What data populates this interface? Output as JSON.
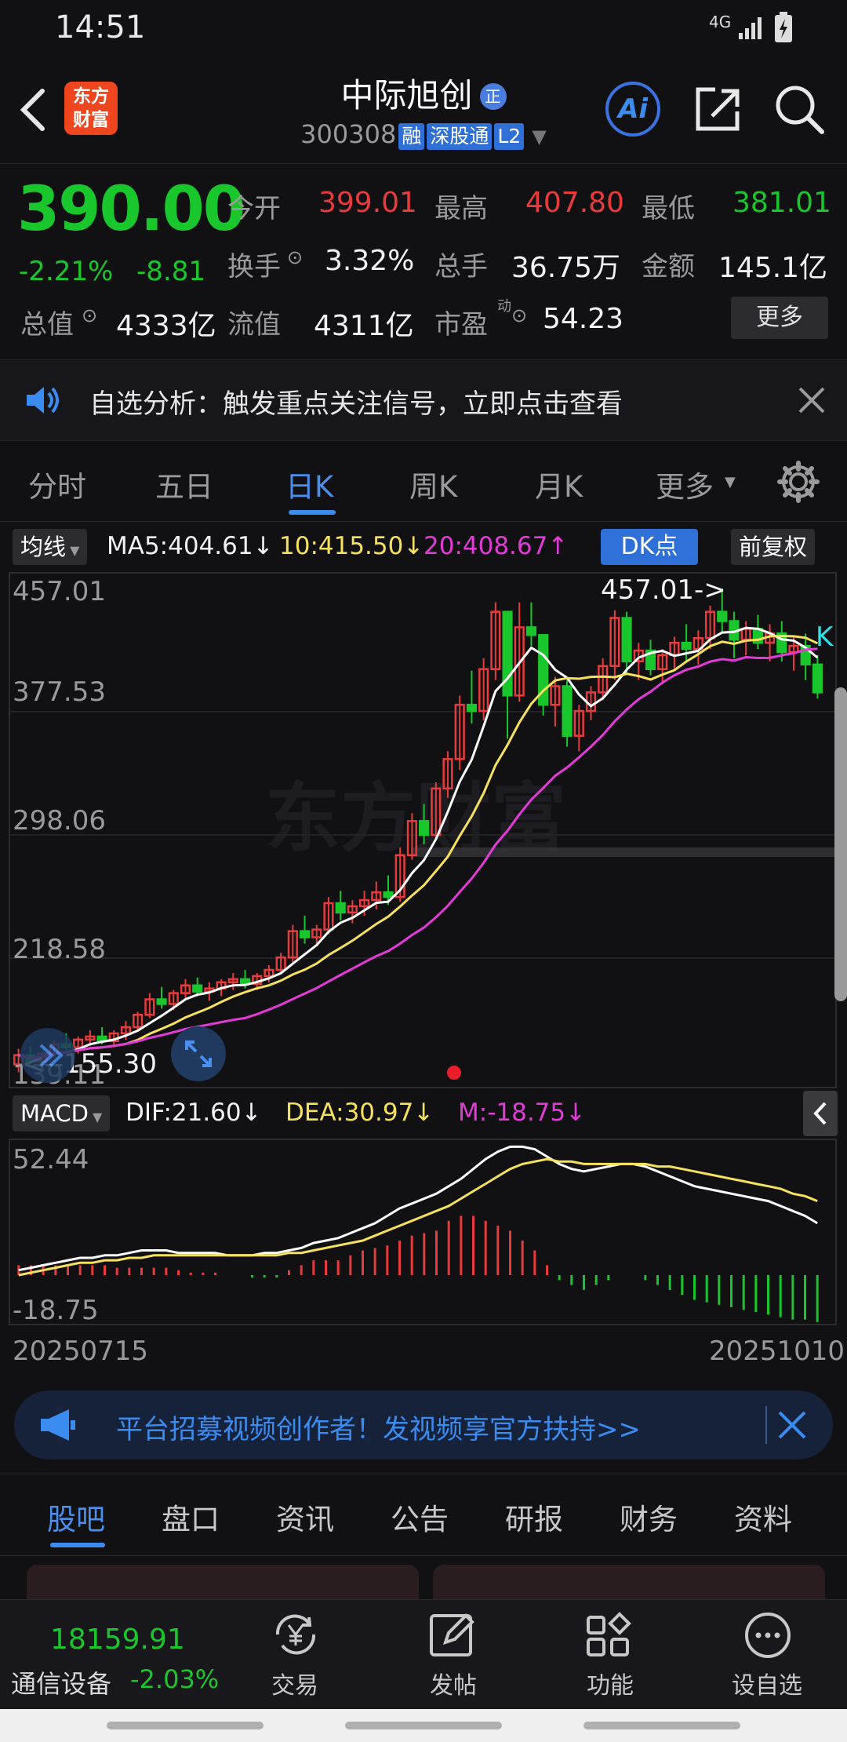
{
  "status": {
    "time": "14:51",
    "network": "4G"
  },
  "header": {
    "logo_line1": "东方",
    "logo_line2": "财富",
    "stock_name": "中际旭创",
    "stock_badge": "正",
    "stock_code": "300308",
    "tags": [
      "融",
      "深股通",
      "L2"
    ],
    "ai_label": "Ai"
  },
  "quote": {
    "price": "390.00",
    "change_pct": "-2.21%",
    "change_abs": "-8.81",
    "open_label": "今开",
    "open": "399.01",
    "high_label": "最高",
    "high": "407.80",
    "low_label": "最低",
    "low": "381.01",
    "turnover_label": "换手",
    "turnover": "3.32%",
    "volume_label": "总手",
    "volume": "36.75万",
    "amount_label": "金额",
    "amount": "145.1亿",
    "mcap_label": "总值",
    "mcap": "4333亿",
    "float_label": "流值",
    "float_cap": "4311亿",
    "pe_label": "市盈",
    "pe_sup": "动",
    "pe": "54.23",
    "more_label": "更多"
  },
  "notice": {
    "text": "自选分析：触发重点关注信号，立即点击查看"
  },
  "period_tabs": [
    {
      "label": "分时"
    },
    {
      "label": "五日"
    },
    {
      "label": "日K"
    },
    {
      "label": "周K"
    },
    {
      "label": "月K"
    },
    {
      "label": "更多"
    }
  ],
  "active_period": "日K",
  "ma_bar": {
    "chip": "均线",
    "ma5": "MA5:404.61↓",
    "ma10": "10:415.50↓",
    "ma20": "20:408.67↑",
    "dk": "DK点",
    "adjust": "前复权"
  },
  "colors": {
    "up": "#e83b3b",
    "down": "#19c62c",
    "ma5": "#ffffff",
    "ma10": "#f5e15a",
    "ma20": "#e23ad6",
    "accent": "#2f6fd8"
  },
  "chart_data": [
    {
      "type": "candlestick",
      "y_ticks": [
        "457.01",
        "377.53",
        "298.06",
        "218.58",
        "139.11"
      ],
      "ylim": [
        139.11,
        457.01
      ],
      "annotations": [
        {
          "text": "457.01->"
        },
        {
          "text": "<--155.30"
        }
      ],
      "k_marker": "K",
      "x_start": "20250715",
      "x_end": "20251010",
      "candles": [
        [
          150,
          160,
          145,
          156
        ],
        [
          156,
          162,
          150,
          152
        ],
        [
          152,
          158,
          148,
          157
        ],
        [
          157,
          166,
          155,
          163
        ],
        [
          163,
          170,
          159,
          161
        ],
        [
          161,
          168,
          157,
          166
        ],
        [
          166,
          172,
          162,
          168
        ],
        [
          168,
          174,
          163,
          165
        ],
        [
          165,
          172,
          161,
          170
        ],
        [
          170,
          178,
          166,
          174
        ],
        [
          174,
          184,
          171,
          182
        ],
        [
          182,
          196,
          180,
          192
        ],
        [
          192,
          200,
          186,
          189
        ],
        [
          189,
          198,
          185,
          196
        ],
        [
          196,
          205,
          192,
          201
        ],
        [
          201,
          206,
          194,
          197
        ],
        [
          197,
          203,
          191,
          199
        ],
        [
          199,
          205,
          194,
          203
        ],
        [
          203,
          209,
          198,
          205
        ],
        [
          205,
          211,
          199,
          202
        ],
        [
          202,
          209,
          198,
          207
        ],
        [
          207,
          214,
          203,
          211
        ],
        [
          211,
          222,
          208,
          219
        ],
        [
          219,
          240,
          216,
          236
        ],
        [
          236,
          246,
          228,
          232
        ],
        [
          232,
          240,
          226,
          237
        ],
        [
          237,
          258,
          234,
          254
        ],
        [
          254,
          262,
          243,
          248
        ],
        [
          248,
          256,
          241,
          252
        ],
        [
          252,
          262,
          246,
          256
        ],
        [
          256,
          268,
          250,
          261
        ],
        [
          261,
          272,
          253,
          258
        ],
        [
          258,
          290,
          255,
          285
        ],
        [
          285,
          312,
          282,
          307
        ],
        [
          307,
          318,
          292,
          298
        ],
        [
          298,
          332,
          295,
          328
        ],
        [
          328,
          352,
          322,
          347
        ],
        [
          347,
          388,
          340,
          382
        ],
        [
          382,
          404,
          370,
          378
        ],
        [
          378,
          412,
          372,
          405
        ],
        [
          405,
          448,
          398,
          442
        ],
        [
          442,
          437,
          360,
          388
        ],
        [
          388,
          448,
          384,
          432
        ],
        [
          432,
          448,
          420,
          427
        ],
        [
          427,
          420,
          375,
          382
        ],
        [
          382,
          400,
          368,
          394
        ],
        [
          394,
          398,
          355,
          362
        ],
        [
          362,
          382,
          352,
          378
        ],
        [
          378,
          394,
          372,
          390
        ],
        [
          390,
          412,
          385,
          407
        ],
        [
          407,
          443,
          398,
          438
        ],
        [
          438,
          442,
          402,
          410
        ],
        [
          410,
          422,
          398,
          417
        ],
        [
          417,
          424,
          401,
          405
        ],
        [
          405,
          418,
          396,
          414
        ],
        [
          414,
          426,
          404,
          422
        ],
        [
          422,
          434,
          410,
          418
        ],
        [
          418,
          430,
          408,
          425
        ],
        [
          425,
          446,
          418,
          442
        ],
        [
          442,
          457,
          428,
          436
        ],
        [
          436,
          442,
          412,
          424
        ],
        [
          424,
          436,
          414,
          431
        ],
        [
          431,
          440,
          418,
          422
        ],
        [
          422,
          434,
          410,
          428
        ],
        [
          428,
          436,
          410,
          416
        ],
        [
          416,
          426,
          404,
          420
        ],
        [
          420,
          428,
          398,
          408
        ],
        [
          408,
          414,
          386,
          390
        ]
      ]
    },
    {
      "type": "macd",
      "indicator_chip": "MACD",
      "dif_label": "DIF:21.60↓",
      "dea_label": "DEA:30.97↓",
      "m_label": "M:-18.75↓",
      "y_ticks": [
        "52.44",
        "-18.75"
      ],
      "ylim": [
        -18.75,
        52.44
      ],
      "dif": [
        2,
        3,
        4,
        5,
        6,
        7,
        7,
        8,
        8,
        9,
        10,
        10,
        10,
        9,
        9,
        9,
        9,
        8,
        8,
        8,
        9,
        9,
        10,
        11,
        13,
        14,
        15,
        17,
        19,
        21,
        24,
        27,
        29,
        31,
        33,
        36,
        39,
        43,
        47,
        50,
        52,
        52,
        51,
        48,
        45,
        43,
        42,
        43,
        44,
        45,
        45,
        44,
        42,
        40,
        38,
        36,
        35,
        34,
        33,
        32,
        31,
        30,
        28,
        26,
        24,
        21
      ],
      "dea": [
        0,
        1,
        2,
        3,
        4,
        5,
        5,
        6,
        6,
        7,
        7,
        8,
        8,
        8,
        8,
        8,
        8,
        8,
        8,
        8,
        8,
        8,
        9,
        9,
        10,
        11,
        12,
        13,
        14,
        16,
        18,
        20,
        22,
        24,
        26,
        28,
        31,
        34,
        37,
        40,
        43,
        45,
        46,
        47,
        46,
        46,
        45,
        45,
        45,
        45,
        45,
        45,
        44,
        44,
        43,
        42,
        41,
        40,
        39,
        38,
        37,
        36,
        35,
        33,
        32,
        30
      ],
      "m": [
        4,
        4,
        4,
        4,
        4,
        4,
        4,
        4,
        3,
        3,
        3,
        3,
        3,
        2,
        1,
        1,
        1,
        0,
        0,
        -1,
        -1,
        -1,
        2,
        4,
        6,
        6,
        6,
        8,
        10,
        11,
        12,
        14,
        16,
        17,
        18,
        22,
        24,
        24,
        22,
        20,
        18,
        14,
        10,
        4,
        -2,
        -4,
        -6,
        -4,
        -2,
        0,
        0,
        -2,
        -4,
        -6,
        -8,
        -10,
        -11,
        -12,
        -13,
        -14,
        -15,
        -16,
        -17,
        -18,
        -18,
        -19
      ]
    }
  ],
  "ad": {
    "text": "平台招募视频创作者！发视频享官方扶持>>"
  },
  "info_tabs": [
    {
      "label": "股吧"
    },
    {
      "label": "盘口"
    },
    {
      "label": "资讯"
    },
    {
      "label": "公告"
    },
    {
      "label": "研报"
    },
    {
      "label": "财务"
    },
    {
      "label": "资料"
    }
  ],
  "active_info": "股吧",
  "bottom_nav": {
    "index_value": "18159.91",
    "sector_name": "通信设备",
    "sector_change": "-2.03%",
    "items": [
      {
        "label": "交易"
      },
      {
        "label": "发帖"
      },
      {
        "label": "功能"
      },
      {
        "label": "设自选"
      }
    ]
  }
}
